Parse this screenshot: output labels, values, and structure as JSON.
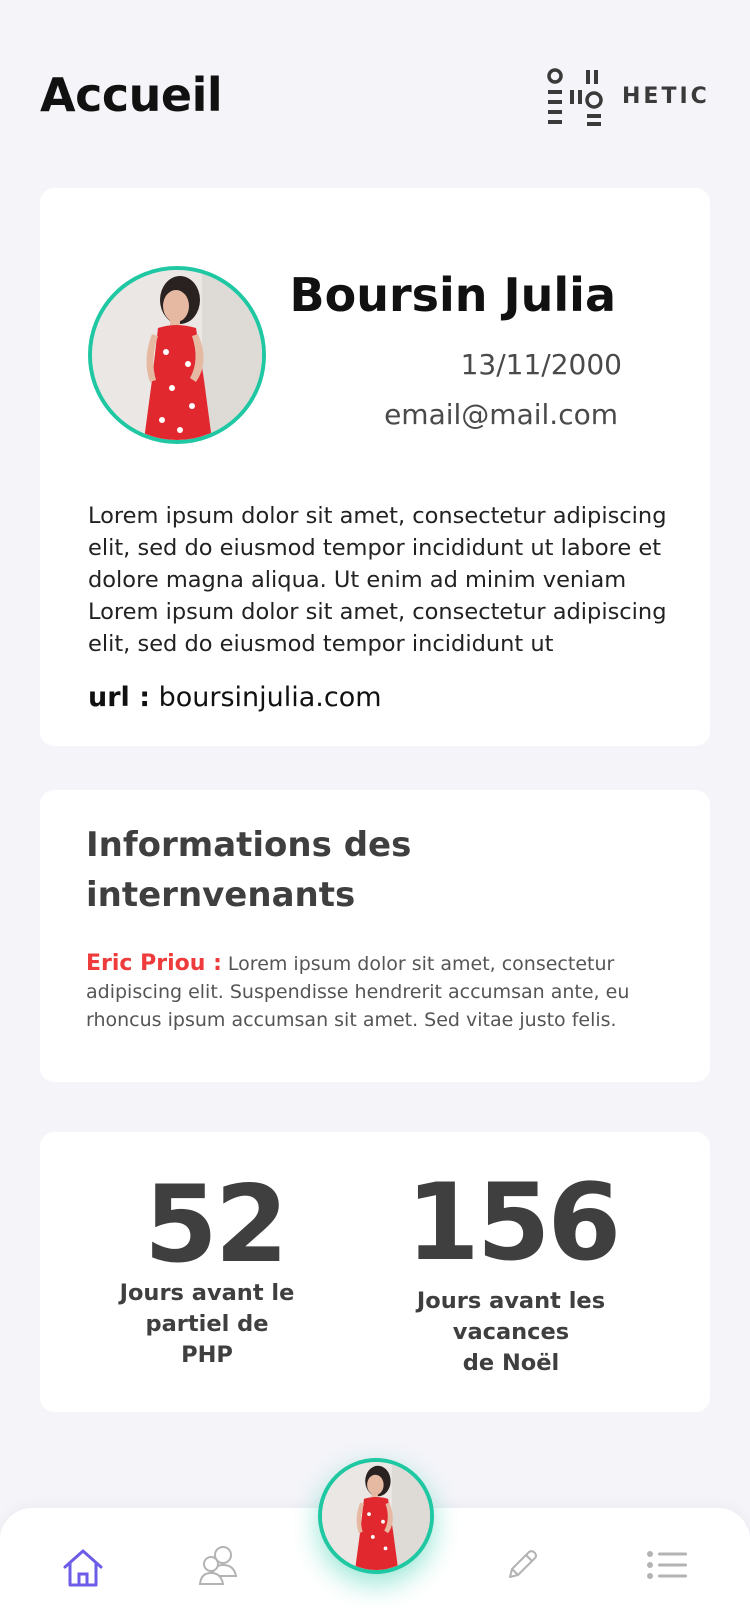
{
  "header": {
    "title": "Accueil",
    "logo_text": "HETIC"
  },
  "profile": {
    "name": "Boursin Julia",
    "birthdate": "13/11/2000",
    "email": "email@mail.com",
    "bio": "Lorem ipsum dolor sit amet, consectetur adipiscing elit, sed do eiusmod tempor incididunt ut labore et dolore magna aliqua. Ut enim ad minim veniam Lorem ipsum dolor sit amet, consectetur adipiscing elit, sed do eiusmod tempor incididunt ut",
    "url_label": "url :",
    "url": "boursinjulia.com"
  },
  "info": {
    "title": "Informations des internvenants",
    "speaker_name": "Eric Priou :",
    "speaker_text": "Lorem ipsum dolor sit amet, consectetur adipiscing elit. Suspendisse hendrerit accumsan ante, eu rhoncus ipsum accumsan sit amet. Sed vitae justo felis."
  },
  "countdown": {
    "first": {
      "value": "52",
      "label_line1": "Jours avant le",
      "label_line2": "partiel de",
      "label_line3": "PHP"
    },
    "second": {
      "value": "156",
      "label_line1": "Jours avant les",
      "label_line2": "vacances",
      "label_line3": "de Noël"
    }
  },
  "nav": {
    "items": [
      {
        "icon": "home-icon",
        "active": true
      },
      {
        "icon": "users-icon",
        "active": false
      },
      {
        "icon": "profile-avatar",
        "active": false
      },
      {
        "icon": "pencil-icon",
        "active": false
      },
      {
        "icon": "list-icon",
        "active": false
      }
    ]
  },
  "colors": {
    "accent": "#1fc8a3",
    "nav_active": "#6c5ce7",
    "highlight": "#ee3b3b",
    "background": "#f4f4f9"
  }
}
